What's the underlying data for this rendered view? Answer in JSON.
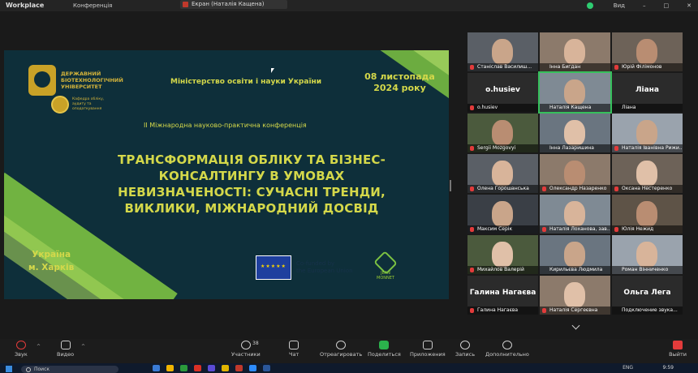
{
  "topbar": {
    "app_title": "Workplace",
    "conference_label": "Конференція",
    "screen_share_label": "Екран (Наталія Кащена)",
    "view_label": "Вид"
  },
  "slide": {
    "university_name": "ДЕРЖАВНИЙ БІОТЕХНОЛОГІЧНИЙ УНІВЕРСИТЕТ",
    "department": "Кафедра обліку, аудиту та оподаткування",
    "ministry": "Міністерство освіти і науки України",
    "date_line1": "08 листопада",
    "date_line2": "2024 року",
    "conference": "ІІ Міжнародна науково-практична конференція",
    "title": "ТРАНСФОРМАЦІЯ ОБЛІКУ ТА БІЗНЕС-КОНСАЛТИНГУ В УМОВАХ НЕВИЗНАЧЕНОСТІ: СУЧАСНІ ТРЕНДИ, ВИКЛИКИ, МІЖНАРОДНИЙ ДОСВІД",
    "place_line1": "Україна",
    "place_line2": "м. Харків",
    "eu_line1": "Co-funded by",
    "eu_line2": "the European Union",
    "jm_label": "JEAN MONNET"
  },
  "participants": [
    {
      "name": "Станіслав Василиш...",
      "kind": "video",
      "muted": true
    },
    {
      "name": "Інна Бигдан",
      "kind": "video",
      "muted": false
    },
    {
      "name": "Юрій Філімонов",
      "kind": "video",
      "muted": true
    },
    {
      "name": "o.husiev",
      "kind": "name",
      "muted": true,
      "display": "o.husiev"
    },
    {
      "name": "Наталія Кащена",
      "kind": "video",
      "muted": false,
      "active": true
    },
    {
      "name": "Ліана",
      "kind": "name",
      "muted": false,
      "display": "Ліана"
    },
    {
      "name": "Sergii Mozgovyi",
      "kind": "video",
      "muted": true
    },
    {
      "name": "Інна Лазаришина",
      "kind": "video",
      "muted": false
    },
    {
      "name": "Наталія Іванівна Рижи...",
      "kind": "video",
      "muted": true
    },
    {
      "name": "Олена Горошанська",
      "kind": "video",
      "muted": true
    },
    {
      "name": "Олександр Назаренко",
      "kind": "video",
      "muted": true
    },
    {
      "name": "Оксана Нестеренко",
      "kind": "video",
      "muted": true
    },
    {
      "name": "Максим Серік",
      "kind": "video",
      "muted": true
    },
    {
      "name": "Наталія Лоханова, зав...",
      "kind": "video",
      "muted": true
    },
    {
      "name": "Юлія Нежид",
      "kind": "video",
      "muted": true
    },
    {
      "name": "Михайлов Валерій",
      "kind": "video",
      "muted": true
    },
    {
      "name": "Кирильєва Людмила",
      "kind": "video",
      "muted": false
    },
    {
      "name": "Роман Вінниченко",
      "kind": "video",
      "muted": false
    },
    {
      "name": "Галина Нагаєва",
      "kind": "name",
      "muted": true,
      "display": "Галина Нагаєва"
    },
    {
      "name": "Наталія Сергеєвна",
      "kind": "video",
      "muted": true
    },
    {
      "name": "Подключение звука...",
      "kind": "name",
      "muted": false,
      "display": "Ольга Лега"
    }
  ],
  "toolbar": {
    "audio": "Звук",
    "video": "Видео",
    "participants": "Участники",
    "participants_count": "38",
    "chat": "Чат",
    "react": "Отреагировать",
    "share": "Поделиться",
    "apps": "Приложения",
    "record": "Запись",
    "more": "Дополнительно",
    "leave": "Выйти"
  },
  "taskbar": {
    "search_placeholder": "Поиск",
    "lang": "ENG",
    "time": "9:59"
  },
  "colors": {
    "slide_bg": "#0e2f3a",
    "accent_green": "#7cc242",
    "title_yellow": "#d4d84a",
    "gold": "#c9a227",
    "active_speaker": "#36c05c",
    "leave_red": "#e23b3b"
  }
}
